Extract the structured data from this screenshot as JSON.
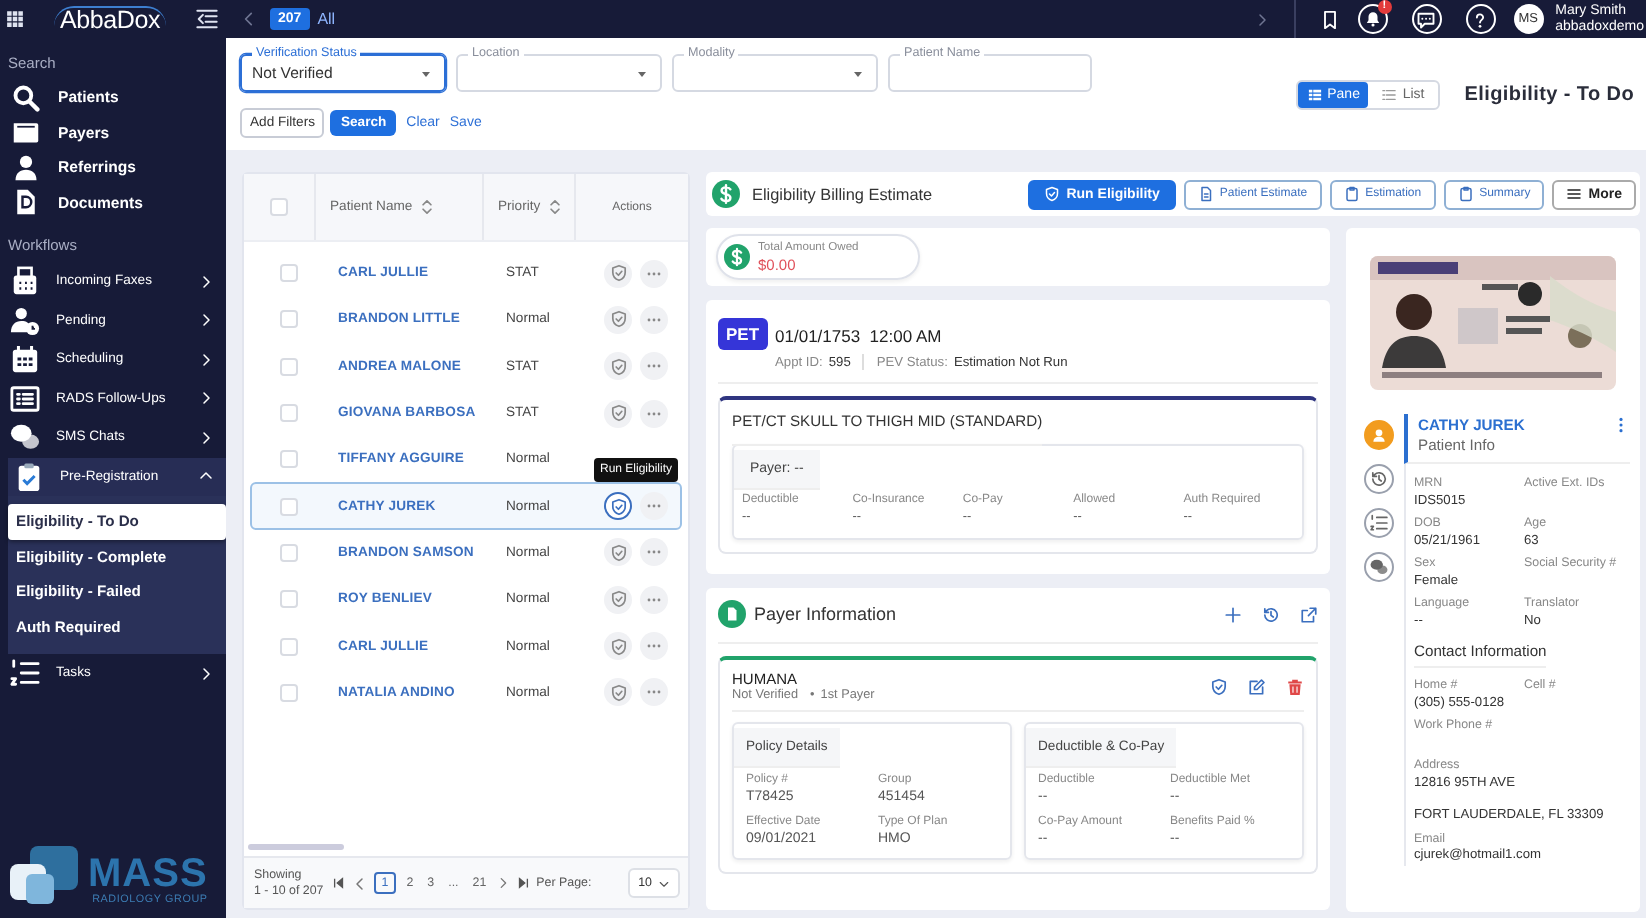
{
  "sidebar": {
    "logo": "AbbaDox",
    "search_heading": "Search",
    "search_items": [
      "Patients",
      "Payers",
      "Referrings",
      "Documents"
    ],
    "workflows_heading": "Workflows",
    "workflows": [
      {
        "label": "Incoming Faxes",
        "expanded": false
      },
      {
        "label": "Pending",
        "expanded": false
      },
      {
        "label": "Scheduling",
        "expanded": false
      },
      {
        "label": "RADS Follow-Ups",
        "expanded": false
      },
      {
        "label": "SMS Chats",
        "expanded": false
      },
      {
        "label": "Pre-Registration",
        "expanded": true,
        "children": [
          {
            "label": "Eligibility - To Do",
            "selected": true
          },
          {
            "label": "Eligibility - Complete",
            "selected": false
          },
          {
            "label": "Eligibility - Failed",
            "selected": false
          },
          {
            "label": "Auth Required",
            "selected": false
          }
        ]
      },
      {
        "label": "Tasks",
        "expanded": false
      }
    ],
    "footer_logo": {
      "name": "MASS",
      "tagline": "RADIOLOGY GROUP"
    }
  },
  "topbar": {
    "count": "207",
    "tab": "All",
    "alert_badge": "!",
    "user": {
      "initials": "MS",
      "name": "Mary Smith",
      "username": "abbadoxdemo"
    }
  },
  "filters": [
    {
      "label": "Verification Status",
      "value": "Not Verified",
      "kind": "select",
      "focused": true
    },
    {
      "label": "Location",
      "kind": "select",
      "focused": false
    },
    {
      "label": "Modality",
      "kind": "select",
      "focused": false
    },
    {
      "label": "Patient Name",
      "kind": "text",
      "focused": false
    }
  ],
  "filter_actions": {
    "add_filters": "Add Filters",
    "search": "Search",
    "clear": "Clear",
    "save": "Save"
  },
  "view_toggle": [
    {
      "label": "Pane",
      "selected": true
    },
    {
      "label": "List",
      "selected": false
    }
  ],
  "page_title": "Eligibility - To Do",
  "patients": {
    "select_all_checked": false,
    "columns": [
      "Patient Name",
      "Priority",
      "Actions"
    ],
    "tooltip": "Run Eligibility",
    "rows": [
      {
        "name": "CARL JULLIE",
        "priority": "STAT",
        "selected": false,
        "checked": false
      },
      {
        "name": "BRANDON LITTLE",
        "priority": "Normal",
        "selected": false,
        "checked": false
      },
      {
        "name": "ANDREA MALONE",
        "priority": "STAT",
        "selected": false,
        "checked": false
      },
      {
        "name": "GIOVANA BARBOSA",
        "priority": "STAT",
        "selected": false,
        "checked": false
      },
      {
        "name": "TIFFANY AGGUIRE",
        "priority": "Normal",
        "selected": false,
        "checked": false
      },
      {
        "name": "CATHY JUREK",
        "priority": "Normal",
        "selected": true,
        "checked": false
      },
      {
        "name": "BRANDON SAMSON",
        "priority": "Normal",
        "selected": false,
        "checked": false
      },
      {
        "name": "ROY BENLIEV",
        "priority": "Normal",
        "selected": false,
        "checked": false
      },
      {
        "name": "CARL JULLIE",
        "priority": "Normal",
        "selected": false,
        "checked": false
      },
      {
        "name": "NATALIA ANDINO",
        "priority": "Normal",
        "selected": false,
        "checked": false
      }
    ]
  },
  "pagination": {
    "showing_label": "Showing",
    "range": "1 - 10 of 207",
    "pages": [
      {
        "label": "1",
        "selected": true
      },
      {
        "label": "2",
        "selected": false
      },
      {
        "label": "3",
        "selected": false
      },
      {
        "label": "...",
        "selected": false
      },
      {
        "label": "21",
        "selected": false
      }
    ],
    "per_page_label": "Per Page:",
    "per_page": "10"
  },
  "estimate": {
    "title": "Eligibility Billing Estimate",
    "buttons": [
      {
        "label": "Run Eligibility",
        "primary": true
      },
      {
        "label": "Patient Estimate",
        "primary": false
      },
      {
        "label": "Estimation",
        "primary": false
      },
      {
        "label": "Summary",
        "primary": false
      },
      {
        "label": "More",
        "primary": false
      }
    ],
    "total": {
      "label": "Total Amount Owed",
      "value": "$0.00"
    },
    "appointment": {
      "badge": "PET",
      "datetime": "01/01/1753  12:00 AM",
      "appt_id_label": "Appt ID:",
      "appt_id": "595",
      "pev_label": "PEV Status:",
      "pev": "Estimation Not Run",
      "procedure": "PET/CT SKULL TO THIGH MID (STANDARD)",
      "payer": "Payer: --",
      "fields": [
        {
          "label": "Deductible",
          "value": "--"
        },
        {
          "label": "Co-Insurance",
          "value": "--"
        },
        {
          "label": "Co-Pay",
          "value": "--"
        },
        {
          "label": "Allowed",
          "value": "--"
        },
        {
          "label": "Auth Required",
          "value": "--"
        }
      ]
    }
  },
  "payer_info": {
    "title": "Payer Information",
    "name": "HUMANA",
    "status": "Not Verified",
    "separator": "•",
    "order": "1st Payer",
    "sections": [
      {
        "title": "Policy Details",
        "fields": [
          {
            "label": "Policy #",
            "value": "T78425"
          },
          {
            "label": "Group",
            "value": "451454"
          },
          {
            "label": "Effective Date",
            "value": "09/01/2021"
          },
          {
            "label": "Type Of Plan",
            "value": "HMO"
          }
        ]
      },
      {
        "title": "Deductible & Co-Pay",
        "fields": [
          {
            "label": "Deductible",
            "value": "--"
          },
          {
            "label": "Deductible Met",
            "value": "--"
          },
          {
            "label": "Co-Pay Amount",
            "value": "--"
          },
          {
            "label": "Benefits Paid %",
            "value": "--"
          }
        ]
      }
    ]
  },
  "patient": {
    "name": "CATHY JUREK",
    "subtitle": "Patient Info",
    "side_tabs": [
      {
        "selected": true
      },
      {
        "selected": false
      },
      {
        "selected": false
      },
      {
        "selected": false
      }
    ],
    "fields": [
      {
        "label": "MRN",
        "value": "IDS5015"
      },
      {
        "label": "Active Ext. IDs"
      },
      {
        "label": "DOB",
        "value": "05/21/1961"
      },
      {
        "label": "Age",
        "value": "63"
      },
      {
        "label": "Sex",
        "value": "Female"
      },
      {
        "label": "Social Security #"
      },
      {
        "label": "Language",
        "value": "--"
      },
      {
        "label": "Translator",
        "value": "No"
      }
    ],
    "contact": {
      "title": "Contact Information",
      "fields": [
        {
          "label": "Home #",
          "value": "(305) 555-0128"
        },
        {
          "label": "Cell #"
        },
        {
          "label": "Work Phone #"
        }
      ],
      "address_label": "Address",
      "address_lines": [
        "12816 95TH AVE",
        "FORT LAUDERDALE, FL 33309"
      ],
      "email_label": "Email",
      "email": "cjurek@hotmail1.com"
    }
  }
}
